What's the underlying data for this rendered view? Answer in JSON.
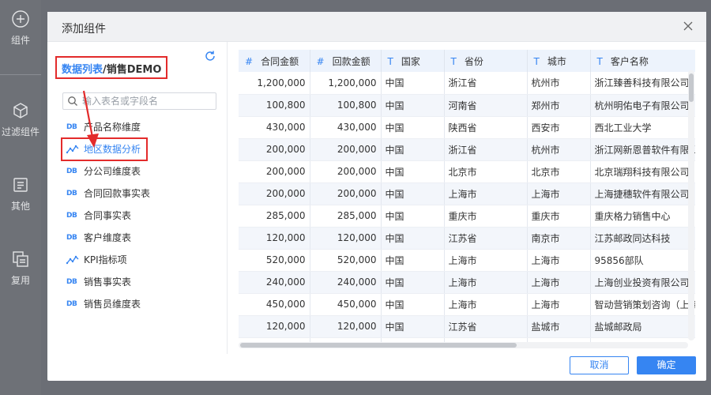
{
  "sidebar": {
    "items": [
      {
        "label": "组件",
        "icon": "plus-circle-icon"
      },
      {
        "label": "过滤组件",
        "icon": "cube-icon"
      },
      {
        "label": "其他",
        "icon": "document-icon"
      },
      {
        "label": "复用",
        "icon": "copy-icon"
      }
    ]
  },
  "dialog": {
    "title": "添加组件",
    "close_icon": "close-icon"
  },
  "left": {
    "crumb_link": "数据列表",
    "crumb_sep": "/",
    "crumb_pkg": "销售DEMO",
    "refresh_icon": "refresh-icon",
    "search_placeholder": "输入表名或字段名",
    "tables": [
      {
        "label": "产品名称维度",
        "type": "DB"
      },
      {
        "label": "地区数据分析",
        "type": "analysis",
        "active": true
      },
      {
        "label": "分公司维度表",
        "type": "DB"
      },
      {
        "label": "合同回款事实表",
        "type": "DB"
      },
      {
        "label": "合同事实表",
        "type": "DB"
      },
      {
        "label": "客户维度表",
        "type": "DB"
      },
      {
        "label": "KPI指标项",
        "type": "analysis"
      },
      {
        "label": "销售事实表",
        "type": "DB"
      },
      {
        "label": "销售员维度表",
        "type": "DB"
      }
    ],
    "db_tag": "DB"
  },
  "table": {
    "columns": [
      {
        "type_icon": "#",
        "label": "合同金额"
      },
      {
        "type_icon": "#",
        "label": "回款金额"
      },
      {
        "type_icon": "T",
        "label": "国家"
      },
      {
        "type_icon": "T",
        "label": "省份"
      },
      {
        "type_icon": "T",
        "label": "城市"
      },
      {
        "type_icon": "T",
        "label": "客户名称"
      }
    ],
    "rows": [
      [
        "1,200,000",
        "1,200,000",
        "中国",
        "浙江省",
        "杭州市",
        "浙江臻善科技有限公司"
      ],
      [
        "100,800",
        "100,800",
        "中国",
        "河南省",
        "郑州市",
        "杭州明佑电子有限公司"
      ],
      [
        "430,000",
        "430,000",
        "中国",
        "陕西省",
        "西安市",
        "西北工业大学"
      ],
      [
        "200,000",
        "200,000",
        "中国",
        "浙江省",
        "杭州市",
        "浙江网新恩普软件有限公"
      ],
      [
        "200,000",
        "200,000",
        "中国",
        "北京市",
        "北京市",
        "北京瑞翔科技有限公司"
      ],
      [
        "200,000",
        "200,000",
        "中国",
        "上海市",
        "上海市",
        "上海捷穗软件有限公司"
      ],
      [
        "285,000",
        "285,000",
        "中国",
        "重庆市",
        "重庆市",
        "重庆格力销售中心"
      ],
      [
        "120,000",
        "120,000",
        "中国",
        "江苏省",
        "南京市",
        "江苏邮政同达科技"
      ],
      [
        "520,000",
        "520,000",
        "中国",
        "上海市",
        "上海市",
        "95856部队"
      ],
      [
        "240,000",
        "240,000",
        "中国",
        "上海市",
        "上海市",
        "上海创业投资有限公司"
      ],
      [
        "450,000",
        "450,000",
        "中国",
        "上海市",
        "上海市",
        "智动营销策划咨询（上海"
      ],
      [
        "120,000",
        "120,000",
        "中国",
        "江苏省",
        "盐城市",
        "盐城邮政局"
      ],
      [
        "",
        "",
        "",
        "",
        "",
        ""
      ]
    ]
  },
  "footer": {
    "cancel_label": "取消",
    "ok_label": "确定"
  },
  "colors": {
    "accent": "#3685f2",
    "highlight": "#e32b2b",
    "header_bg": "#edf3fc"
  }
}
